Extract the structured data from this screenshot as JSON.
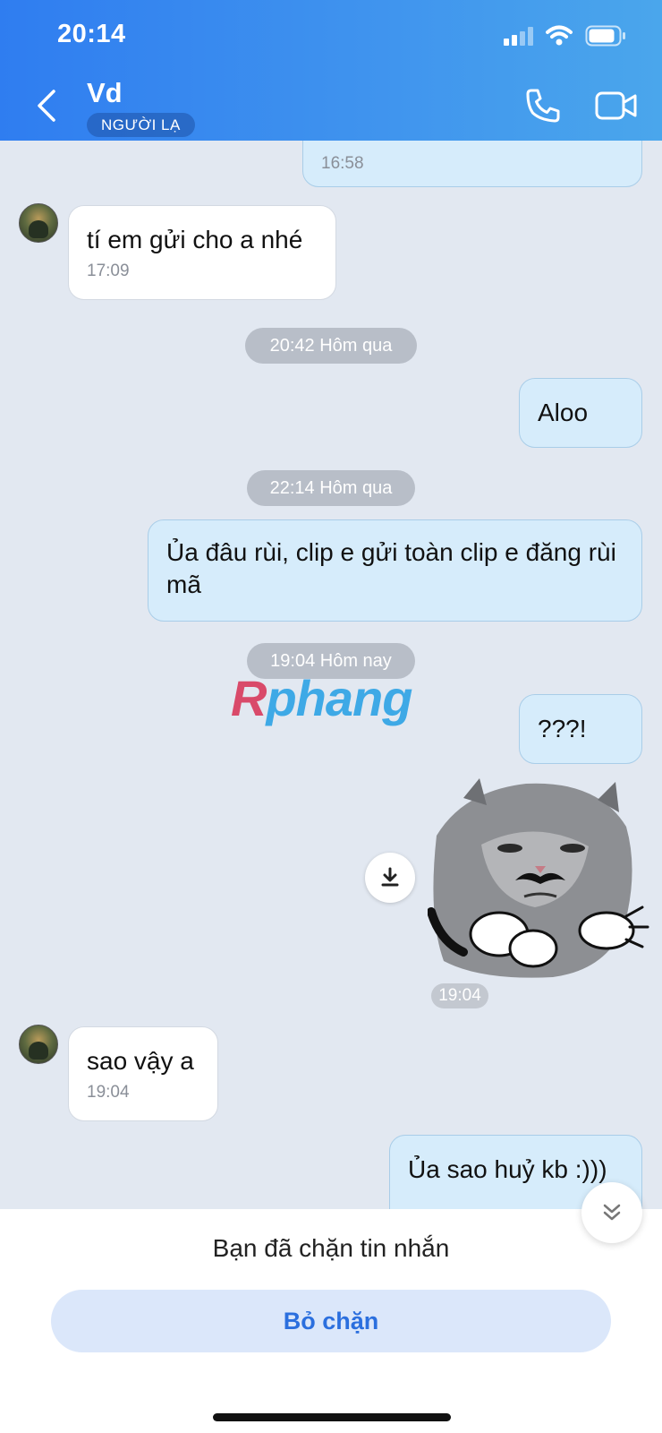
{
  "status_bar": {
    "time": "20:14"
  },
  "header": {
    "title": "Vd",
    "badge": "NGƯỜI LẠ",
    "icons": {
      "back": "back-chevron-icon",
      "call": "phone-icon",
      "video": "video-camera-icon"
    }
  },
  "messages": [
    {
      "direction": "out",
      "text": "",
      "time": "16:58"
    },
    {
      "direction": "in",
      "text": "tí em gửi cho a nhé",
      "time": "17:09"
    },
    {
      "separator": "20:42 Hôm qua"
    },
    {
      "direction": "out",
      "text": "Aloo",
      "time": ""
    },
    {
      "separator": "22:14 Hôm qua"
    },
    {
      "direction": "out",
      "text": "Ủa đâu rùi, clip e gửi toàn clip e đăng rùi mã",
      "time": ""
    },
    {
      "separator": "19:04 Hôm nay"
    },
    {
      "direction": "out",
      "text": "???!",
      "time": ""
    },
    {
      "direction": "out",
      "type": "sticker",
      "sticker": "grumpy-cat-mustache-sticker",
      "time": "19:04"
    },
    {
      "direction": "in",
      "text": "sao vậy a",
      "time": "19:04"
    },
    {
      "direction": "out",
      "text": "Ủa sao huỷ kb :)))",
      "time": ""
    }
  ],
  "watermark": {
    "first": "R",
    "rest": "phang"
  },
  "bottom": {
    "notice": "Bạn đã chặn tin nhắn",
    "unblock_label": "Bỏ chặn"
  },
  "colors": {
    "header_start": "#2f7df0",
    "header_end": "#4aa6ec",
    "chat_bg": "#e2e8f1",
    "outgoing_bubble": "#d6ecfb",
    "incoming_bubble": "#ffffff",
    "unblock_text": "#2b6fde"
  }
}
